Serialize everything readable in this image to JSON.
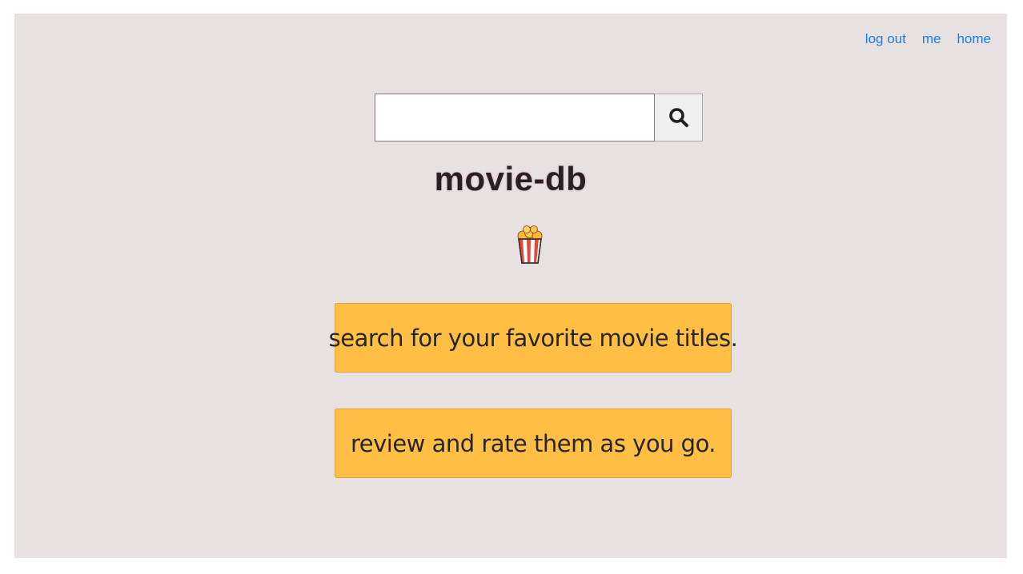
{
  "nav": {
    "items": [
      {
        "label": "log out"
      },
      {
        "label": "me"
      },
      {
        "label": "home"
      }
    ],
    "link_color": "#1a7fe6"
  },
  "search": {
    "value": "",
    "placeholder": "",
    "button_icon": "search-icon"
  },
  "hero": {
    "title": "movie-db",
    "icon": "popcorn-icon"
  },
  "features": [
    {
      "text": "search for your favorite movie titles."
    },
    {
      "text": "review and rate them as you go."
    }
  ],
  "colors": {
    "background": "#e7e1e1",
    "card": "#ffbe44",
    "title": "#2a1f24"
  }
}
